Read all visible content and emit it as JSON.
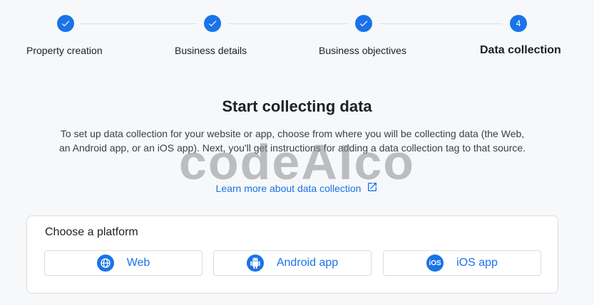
{
  "stepper": {
    "steps": [
      {
        "label": "Property creation",
        "state": "done",
        "icon": "check-icon"
      },
      {
        "label": "Business details",
        "state": "done",
        "icon": "check-icon"
      },
      {
        "label": "Business objectives",
        "state": "done",
        "icon": "check-icon"
      },
      {
        "label": "Data collection",
        "state": "current",
        "number": "4"
      }
    ]
  },
  "main": {
    "title": "Start collecting data",
    "description": "To set up data collection for your website or app, choose from where you will be collecting data (the Web, an Android app, or an iOS app). Next, you'll get instructions for adding a data collection tag to that source.",
    "learn_more": "Learn more about data collection",
    "learn_more_icon": "open-in-new-icon"
  },
  "platform_card": {
    "title": "Choose a platform",
    "buttons": [
      {
        "label": "Web",
        "icon": "globe-icon"
      },
      {
        "label": "Android app",
        "icon": "android-icon"
      },
      {
        "label": "iOS app",
        "icon": "ios-icon",
        "icon_text": "iOS"
      }
    ]
  },
  "watermark": "codeAIco",
  "colors": {
    "accent": "#1a73e8",
    "background": "#f7f8fa",
    "border": "#dadce0"
  }
}
